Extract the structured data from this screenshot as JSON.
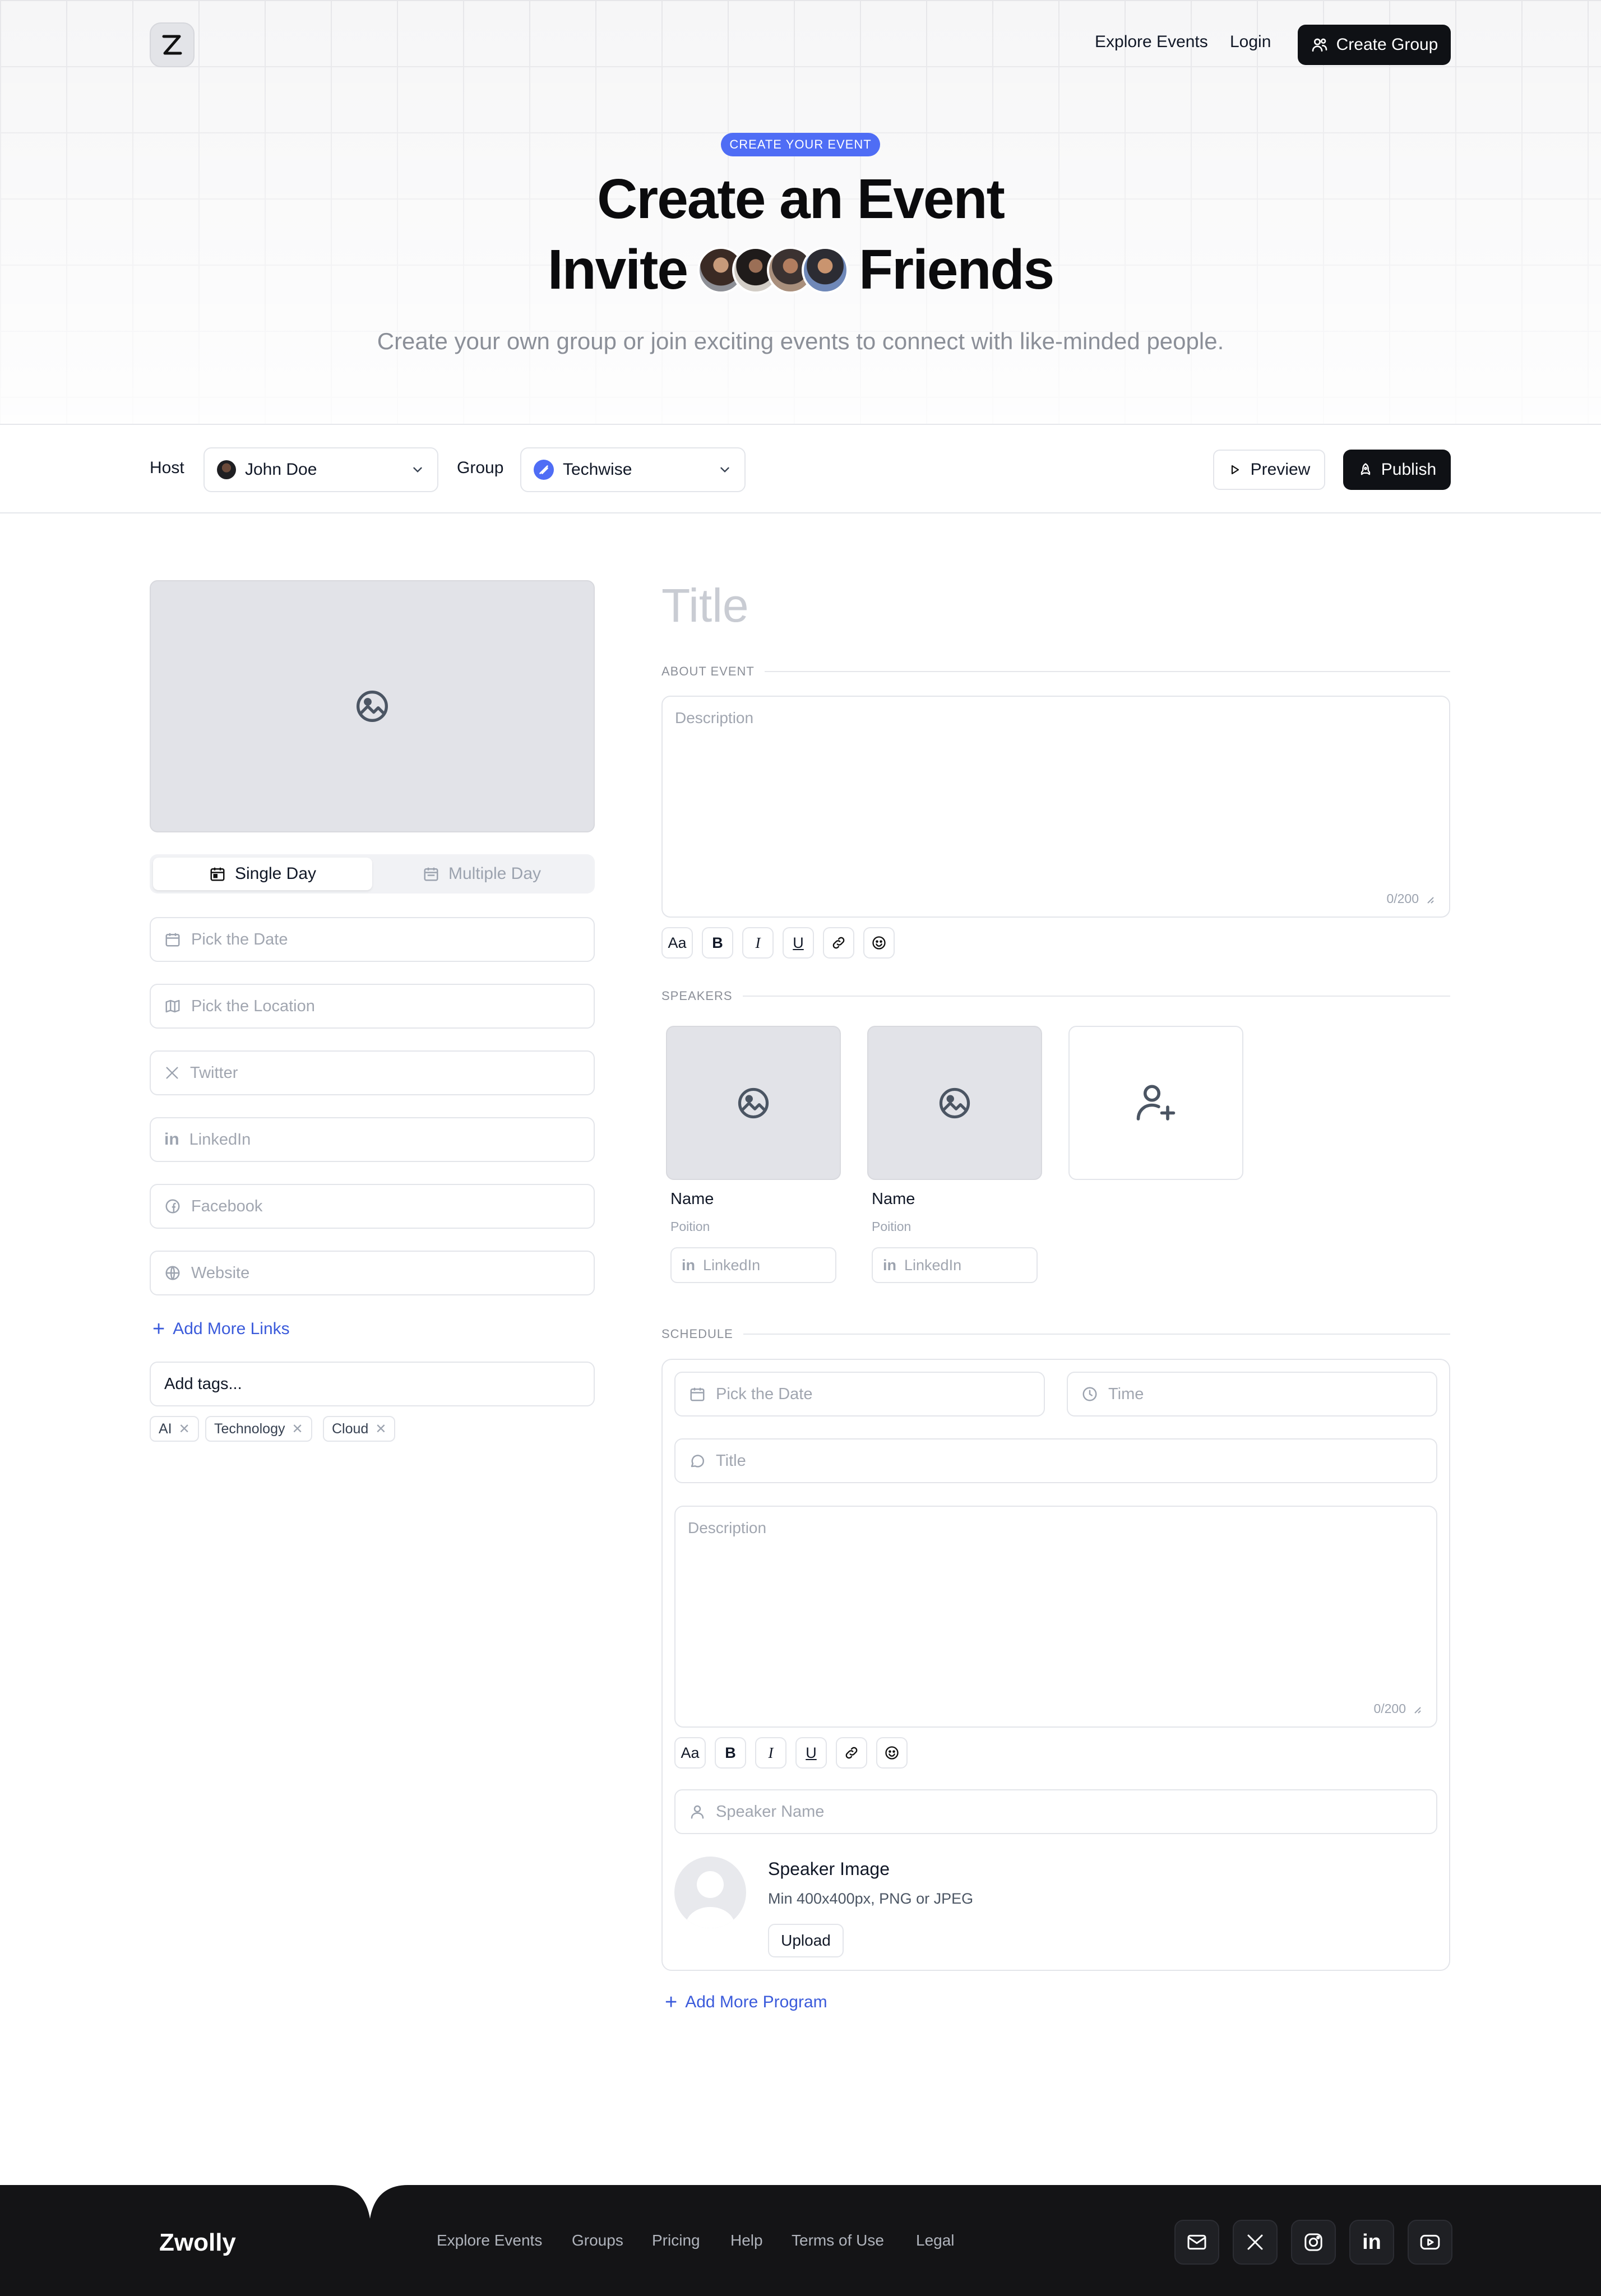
{
  "header": {
    "nav": {
      "explore": "Explore Events",
      "login": "Login",
      "create_group": "Create Group"
    }
  },
  "hero": {
    "badge": "CREATE YOUR EVENT",
    "title_line1": "Create an Event",
    "title_invite": "Invite",
    "title_friends": "Friends",
    "subtitle": "Create your own group or join exciting events to connect with like-minded people."
  },
  "hostbar": {
    "host_label": "Host",
    "host_value": "John Doe",
    "group_label": "Group",
    "group_value": "Techwise",
    "preview": "Preview",
    "publish": "Publish"
  },
  "left": {
    "segments": {
      "single": "Single Day",
      "multiple": "Multiple Day",
      "active": "single"
    },
    "fields": {
      "date": "Pick the Date",
      "location": "Pick the Location",
      "twitter": "Twitter",
      "linkedin": "LinkedIn",
      "facebook": "Facebook",
      "website": "Website"
    },
    "add_links": "Add More Links",
    "tags_placeholder": "Add tags...",
    "tags": [
      "AI",
      "Technology",
      "Cloud"
    ]
  },
  "main": {
    "title_placeholder": "Title",
    "about_label": "ABOUT EVENT",
    "description_placeholder": "Description",
    "char_count": "0/200",
    "toolbar": {
      "text": "Aa",
      "bold": "B",
      "italic": "I",
      "underline": "U"
    },
    "speakers_label": "SPEAKERS",
    "speakers": [
      {
        "name": "Name",
        "position": "Poition",
        "linkedin": "LinkedIn"
      },
      {
        "name": "Name",
        "position": "Poition",
        "linkedin": "LinkedIn"
      }
    ],
    "schedule_label": "SCHEDULE",
    "schedule": {
      "date": "Pick the Date",
      "time": "Time",
      "title": "Title",
      "description": "Description",
      "char_count": "0/200",
      "speaker_name": "Speaker Name",
      "speaker_image_title": "Speaker Image",
      "speaker_image_hint": "Min 400x400px, PNG or JPEG",
      "upload": "Upload"
    },
    "add_program": "Add More Program"
  },
  "footer": {
    "brand": "Zwolly",
    "links": [
      "Explore Events",
      "Groups",
      "Pricing",
      "Help",
      "Terms of Use",
      "Legal"
    ],
    "social_icons": [
      "mail-icon",
      "x-icon",
      "instagram-icon",
      "linkedin-icon",
      "youtube-icon"
    ]
  },
  "colors": {
    "accent_blue": "#4f6df5",
    "link_blue": "#3b5bdb",
    "dark": "#0f1115",
    "footer_bg": "#141416"
  }
}
